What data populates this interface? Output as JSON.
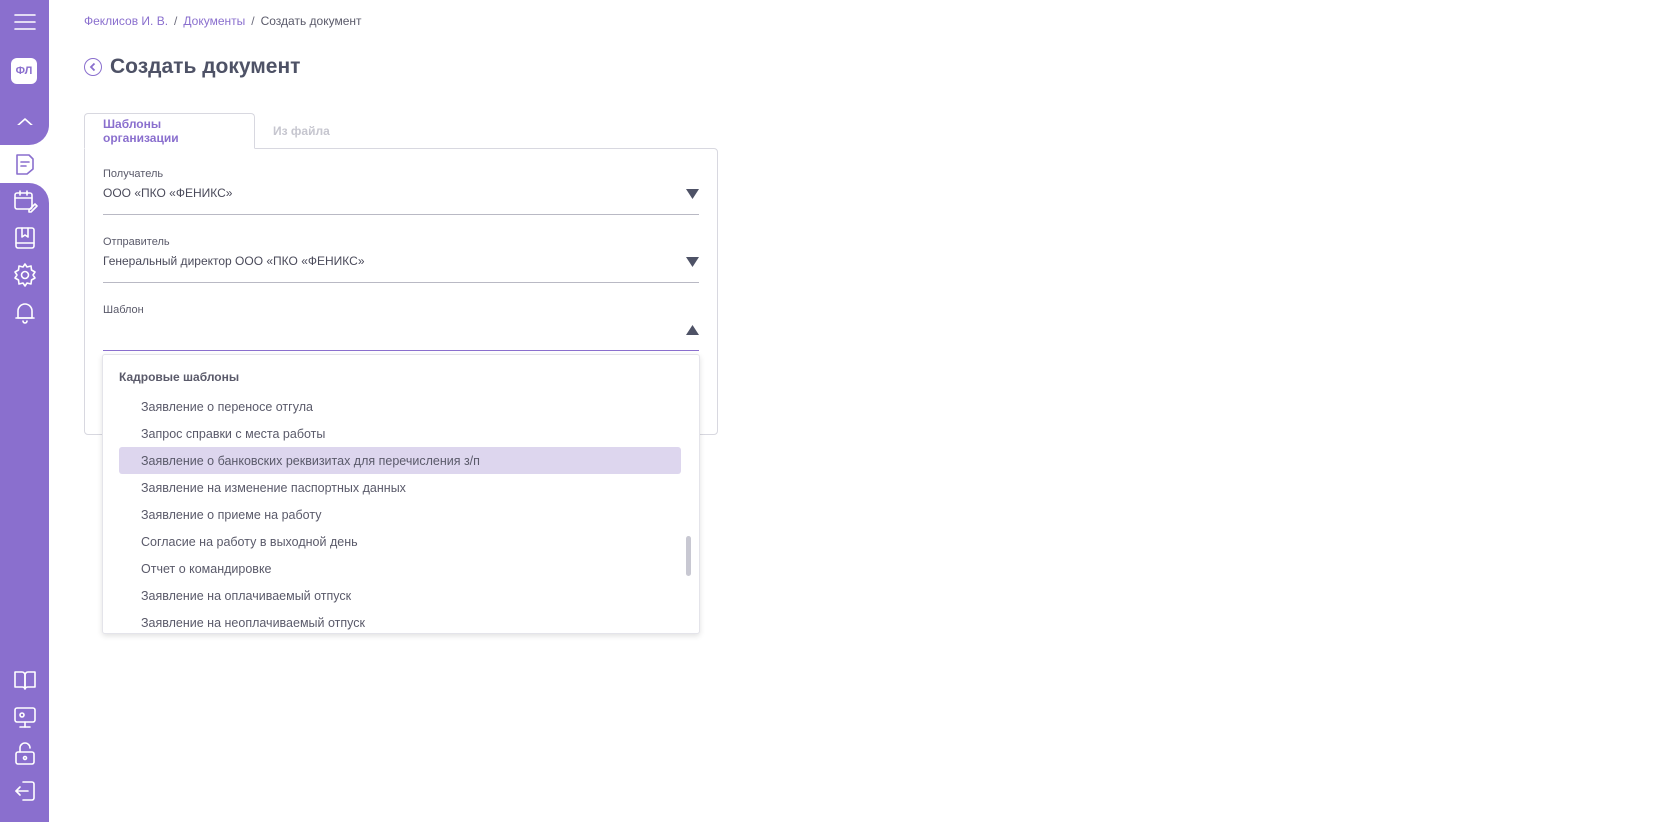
{
  "colors": {
    "accent": "#8a6fce",
    "highlight": "#ddd6ee",
    "text": "#4a4a5a"
  },
  "sidebar": {
    "avatar_text": "ФЛ",
    "icons": [
      "menu-icon",
      "home-icon",
      "document-icon",
      "calendar-edit-icon",
      "bookmark-icon",
      "gear-icon",
      "bell-icon",
      "book-icon",
      "presentation-icon",
      "unlock-icon",
      "logout-icon"
    ],
    "active": "document-icon"
  },
  "breadcrumb": {
    "items": [
      "Феклисов И. В.",
      "Документы",
      "Создать документ"
    ],
    "separator": "/"
  },
  "page": {
    "title": "Создать документ"
  },
  "tabs": [
    {
      "label": "Шаблоны организации",
      "active": true
    },
    {
      "label": "Из файла",
      "active": false
    }
  ],
  "form": {
    "recipient": {
      "label": "Получатель",
      "value": "ООО «ПКО «ФЕНИКС»"
    },
    "sender": {
      "label": "Отправитель",
      "value": "Генеральный директор ООО «ПКО «ФЕНИКС»"
    },
    "template": {
      "label": "Шаблон",
      "value": ""
    }
  },
  "dropdown": {
    "group": "Кадровые шаблоны",
    "items": [
      "Заявление о переносе отгула",
      "Запрос справки с места работы",
      "Заявление о банковских реквизитах для перечисления з/п",
      "Заявление на изменение паспортных данных",
      "Заявление о приеме на работу",
      "Согласие на работу в выходной день",
      "Отчет о командировке",
      "Заявление на оплачиваемый отпуск",
      "Заявление на неоплачиваемый отпуск"
    ],
    "highlighted_index": 2
  }
}
